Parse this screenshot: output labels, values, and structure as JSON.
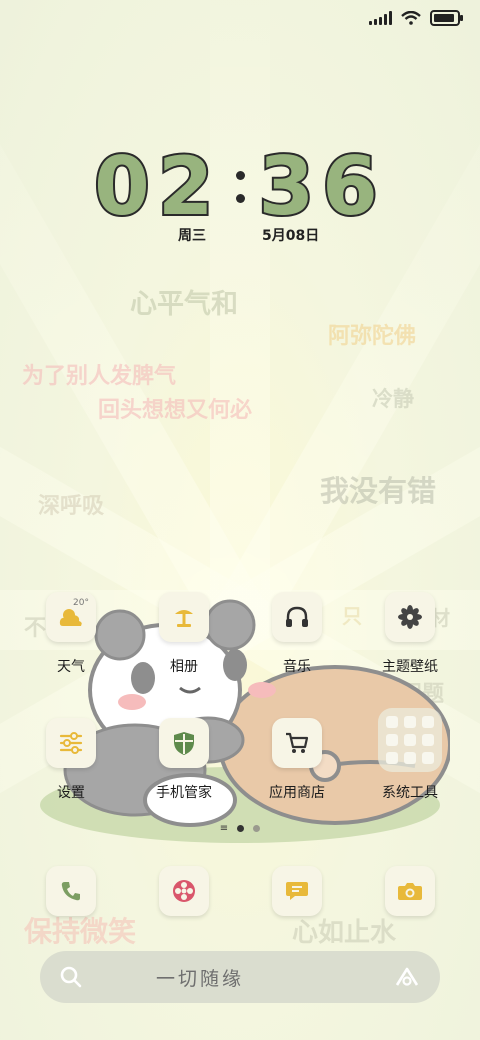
{
  "status_bar": {
    "signal_icon": "signal-icon",
    "wifi_icon": "wifi-icon",
    "battery_icon": "battery-icon",
    "battery_level": 0.9
  },
  "clock": {
    "hours": "02",
    "minutes": "36",
    "weekday": "周三",
    "date": "5月08日"
  },
  "wallpaper_texts": [
    {
      "text": "心平气和",
      "color": "#bfc6a8"
    },
    {
      "text": "阿弥陀佛",
      "color": "#f1d08a"
    },
    {
      "text": "为了别人发脾气",
      "color": "#f5b7b7"
    },
    {
      "text": "回头想想又何必",
      "color": "#f5b7b7"
    },
    {
      "text": "冷静",
      "color": "#c5c9b3"
    },
    {
      "text": "我没有错",
      "color": "#b9bcab"
    },
    {
      "text": "深呼吸",
      "color": "#d4cdb6"
    },
    {
      "text": "不",
      "color": "#c9cbb5"
    },
    {
      "text": "只",
      "color": "#e8dca8"
    },
    {
      "text": "材",
      "color": "#c9cbb5"
    },
    {
      "text": "问题",
      "color": "#c9cbb5"
    },
    {
      "text": "保持微笑",
      "color": "#f5c0b6"
    },
    {
      "text": "心如止水",
      "color": "#c9cbb5"
    }
  ],
  "home_apps": [
    {
      "label": "天气",
      "icon": "weather-icon",
      "temp": "20°"
    },
    {
      "label": "相册",
      "icon": "gallery-icon"
    },
    {
      "label": "音乐",
      "icon": "headphones-icon"
    },
    {
      "label": "主题壁纸",
      "icon": "flower-icon"
    },
    {
      "label": "设置",
      "icon": "sliders-icon"
    },
    {
      "label": "手机管家",
      "icon": "shield-icon"
    },
    {
      "label": "应用商店",
      "icon": "cart-icon"
    },
    {
      "label": "系统工具",
      "icon": "folder-icon"
    }
  ],
  "page_indicator": {
    "pages": 2,
    "current": 1
  },
  "dock": [
    {
      "icon": "phone-icon"
    },
    {
      "icon": "browser-icon"
    },
    {
      "icon": "message-icon"
    },
    {
      "icon": "camera-icon"
    }
  ],
  "search": {
    "placeholder": "一切随缘",
    "search_icon": "search-icon",
    "assistant_icon": "assistant-icon"
  },
  "colors": {
    "accent_green": "#98b47e",
    "accent_yellow": "#e8b93a",
    "icon_bg": "#f7f5e6"
  }
}
